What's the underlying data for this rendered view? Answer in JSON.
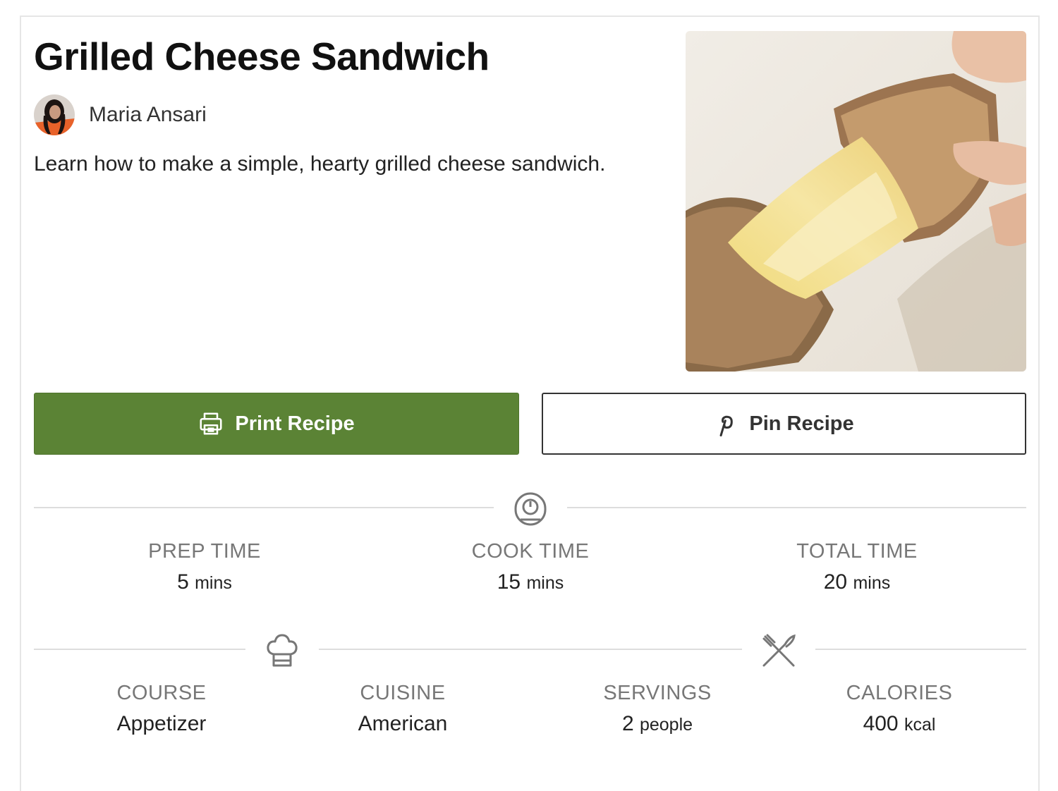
{
  "recipe": {
    "title": "Grilled Cheese Sandwich",
    "author": "Maria Ansari",
    "summary": "Learn how to make a simple, hearty grilled cheese sandwich."
  },
  "buttons": {
    "print_label": "Print Recipe",
    "print_icon": "printer-icon",
    "pin_label": "Pin Recipe",
    "pin_icon": "pinterest-icon"
  },
  "times": {
    "icon": "timer-icon",
    "prep": {
      "label": "PREP TIME",
      "value": "5",
      "unit": "mins"
    },
    "cook": {
      "label": "COOK TIME",
      "value": "15",
      "unit": "mins"
    },
    "total": {
      "label": "TOTAL TIME",
      "value": "20",
      "unit": "mins"
    }
  },
  "details": {
    "course_icon": "chef-hat-icon",
    "servings_icon": "fork-knife-icon",
    "course": {
      "label": "COURSE",
      "value": "Appetizer"
    },
    "cuisine": {
      "label": "CUISINE",
      "value": "American"
    },
    "servings": {
      "label": "SERVINGS",
      "value": "2",
      "unit": "people"
    },
    "calories": {
      "label": "CALORIES",
      "value": "400",
      "unit": "kcal"
    }
  },
  "colors": {
    "print_button": "#5b8335",
    "rule": "#dddddd",
    "label_gray": "#777777"
  }
}
